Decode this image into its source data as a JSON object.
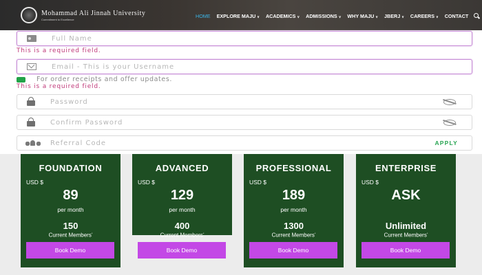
{
  "header": {
    "logo_name": "Mohammad Ali Jinnah University",
    "logo_sub": "Commitment to Excellence",
    "nav": [
      {
        "label": "HOME",
        "active": true,
        "dropdown": false
      },
      {
        "label": "EXPLORE MAJU",
        "active": false,
        "dropdown": true
      },
      {
        "label": "ACADEMICS",
        "active": false,
        "dropdown": true
      },
      {
        "label": "ADMISSIONS",
        "active": false,
        "dropdown": true
      },
      {
        "label": "WHY MAJU",
        "active": false,
        "dropdown": true
      },
      {
        "label": "JBERJ",
        "active": false,
        "dropdown": true
      },
      {
        "label": "CAREERS",
        "active": false,
        "dropdown": true
      },
      {
        "label": "CONTACT",
        "active": false,
        "dropdown": false
      }
    ],
    "search_icon": "search-icon"
  },
  "form": {
    "full_name_placeholder": "Full Name",
    "email_placeholder": "Email - This is your Username",
    "password_placeholder": "Password",
    "confirm_password_placeholder": "Confirm Password",
    "referral_placeholder": "Referral Code",
    "apply_label": "APPLY",
    "required_error": "This is a required field.",
    "consent_text": "For order receipts and offer updates."
  },
  "plans": [
    {
      "name": "FOUNDATION",
      "currency": "USD $",
      "price": "89",
      "period": "per month",
      "members": "150",
      "members_label": "Current Members",
      "button": "Book Demo"
    },
    {
      "name": "ADVANCED",
      "currency": "USD $",
      "price": "129",
      "period": "per month",
      "members": "400",
      "members_label": "Current Members",
      "button": "Book Demo"
    },
    {
      "name": "PROFESSIONAL",
      "currency": "USD $",
      "price": "189",
      "period": "per month",
      "members": "1300",
      "members_label": "Current Members",
      "button": "Book Demo"
    },
    {
      "name": "ENTERPRISE",
      "currency": "USD $",
      "price": "ASK",
      "period": "",
      "members": "Unlimited",
      "members_label": "Current Members",
      "button": "Book Demo"
    }
  ],
  "colors": {
    "plan_bg": "#1e4e23",
    "button_bg": "#c348e6",
    "error_text": "#c03a7a",
    "apply_text": "#2aa553",
    "nav_active": "#3bb6e8"
  }
}
